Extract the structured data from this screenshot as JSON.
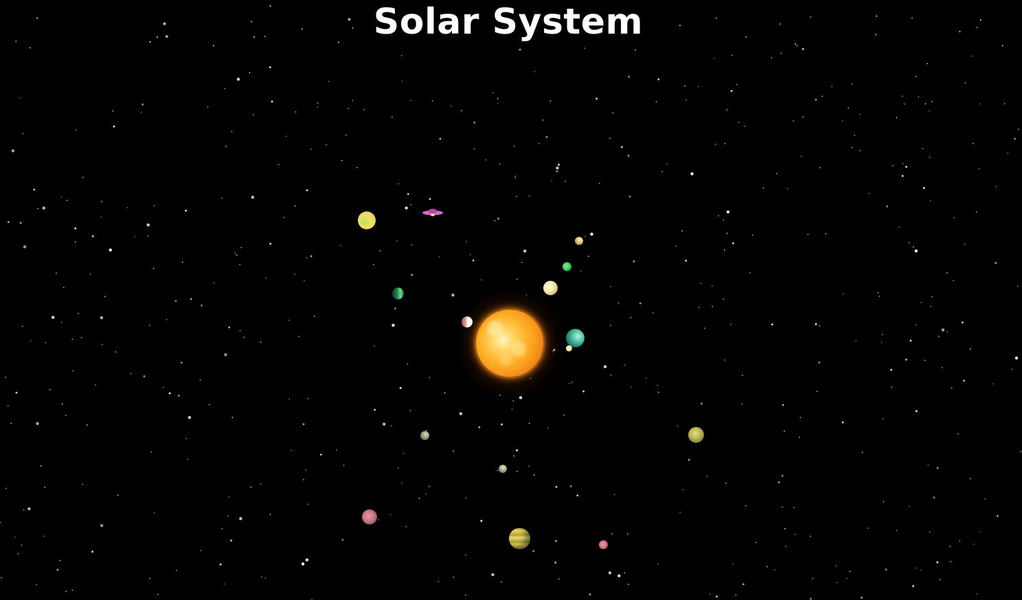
{
  "title": "Solar System",
  "colors": {
    "background": "#000000",
    "title_text": "#ffffff",
    "sun_core": "#ffd86a",
    "sun_edge": "#e2740f",
    "ufo": "#d966c8"
  },
  "objects": {
    "sun": {
      "name": "sun"
    },
    "ufo": {
      "name": "ufo"
    },
    "planet_count": 17
  }
}
